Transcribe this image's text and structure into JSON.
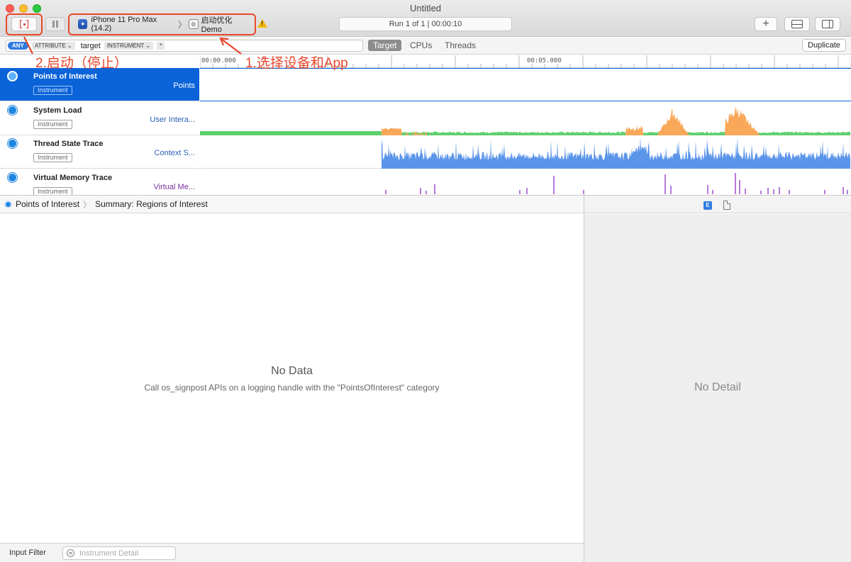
{
  "window": {
    "title": "Untitled"
  },
  "toolbar": {
    "device": "iPhone 11 Pro Max (14.2)",
    "app": "启动优化Demo",
    "run_status": "Run 1 of 1  |  00:00:10"
  },
  "filter": {
    "any": "ANY",
    "attribute": "ATTRIBUTE",
    "target_word": "target",
    "instrument": "INSTRUMENT",
    "star": "*",
    "segments": [
      "Target",
      "CPUs",
      "Threads"
    ],
    "duplicate": "Duplicate"
  },
  "ruler": {
    "start": "00:00.000",
    "mid": "00:05.000"
  },
  "tracks": [
    {
      "name": "Points of Interest",
      "badge": "Instrument",
      "subtitle": "Points"
    },
    {
      "name": "System Load",
      "badge": "Instrument",
      "subtitle": "User Intera..."
    },
    {
      "name": "Thread State Trace",
      "badge": "Instrument",
      "subtitle": "Context S..."
    },
    {
      "name": "Virtual Memory Trace",
      "badge": "Instrument",
      "subtitle": "Virtual Me..."
    }
  ],
  "breadcrumb": {
    "root": "Points of Interest",
    "leaf": "Summary: Regions of Interest"
  },
  "main": {
    "empty_title": "No Data",
    "empty_subtitle": "Call os_signpost APIs on a logging handle with the \"PointsOfInterest\" category"
  },
  "detail": {
    "empty": "No Detail",
    "e_badge": "E"
  },
  "footer": {
    "label": "Input Filter",
    "search_placeholder": "Instrument Detail"
  },
  "annotations": {
    "step1": "1.选择设备和App",
    "step2": "2.启动（停止）"
  },
  "colors": {
    "accent": "#0a63d8",
    "annotation": "#e8472c",
    "load_green": "#5fcf6e",
    "load_orange": "#f9a85a",
    "thread_blue": "#5b95ea",
    "memory_purple": "#b57ad8"
  },
  "icons": [
    "record-icon",
    "pause-icon",
    "device-icon",
    "app-icon",
    "warning-icon",
    "add-icon",
    "layout-bottom-icon",
    "layout-right-icon",
    "search-icon",
    "document-icon",
    "poi-icon",
    "system-load-icon",
    "thread-state-icon",
    "virtual-memory-icon"
  ]
}
